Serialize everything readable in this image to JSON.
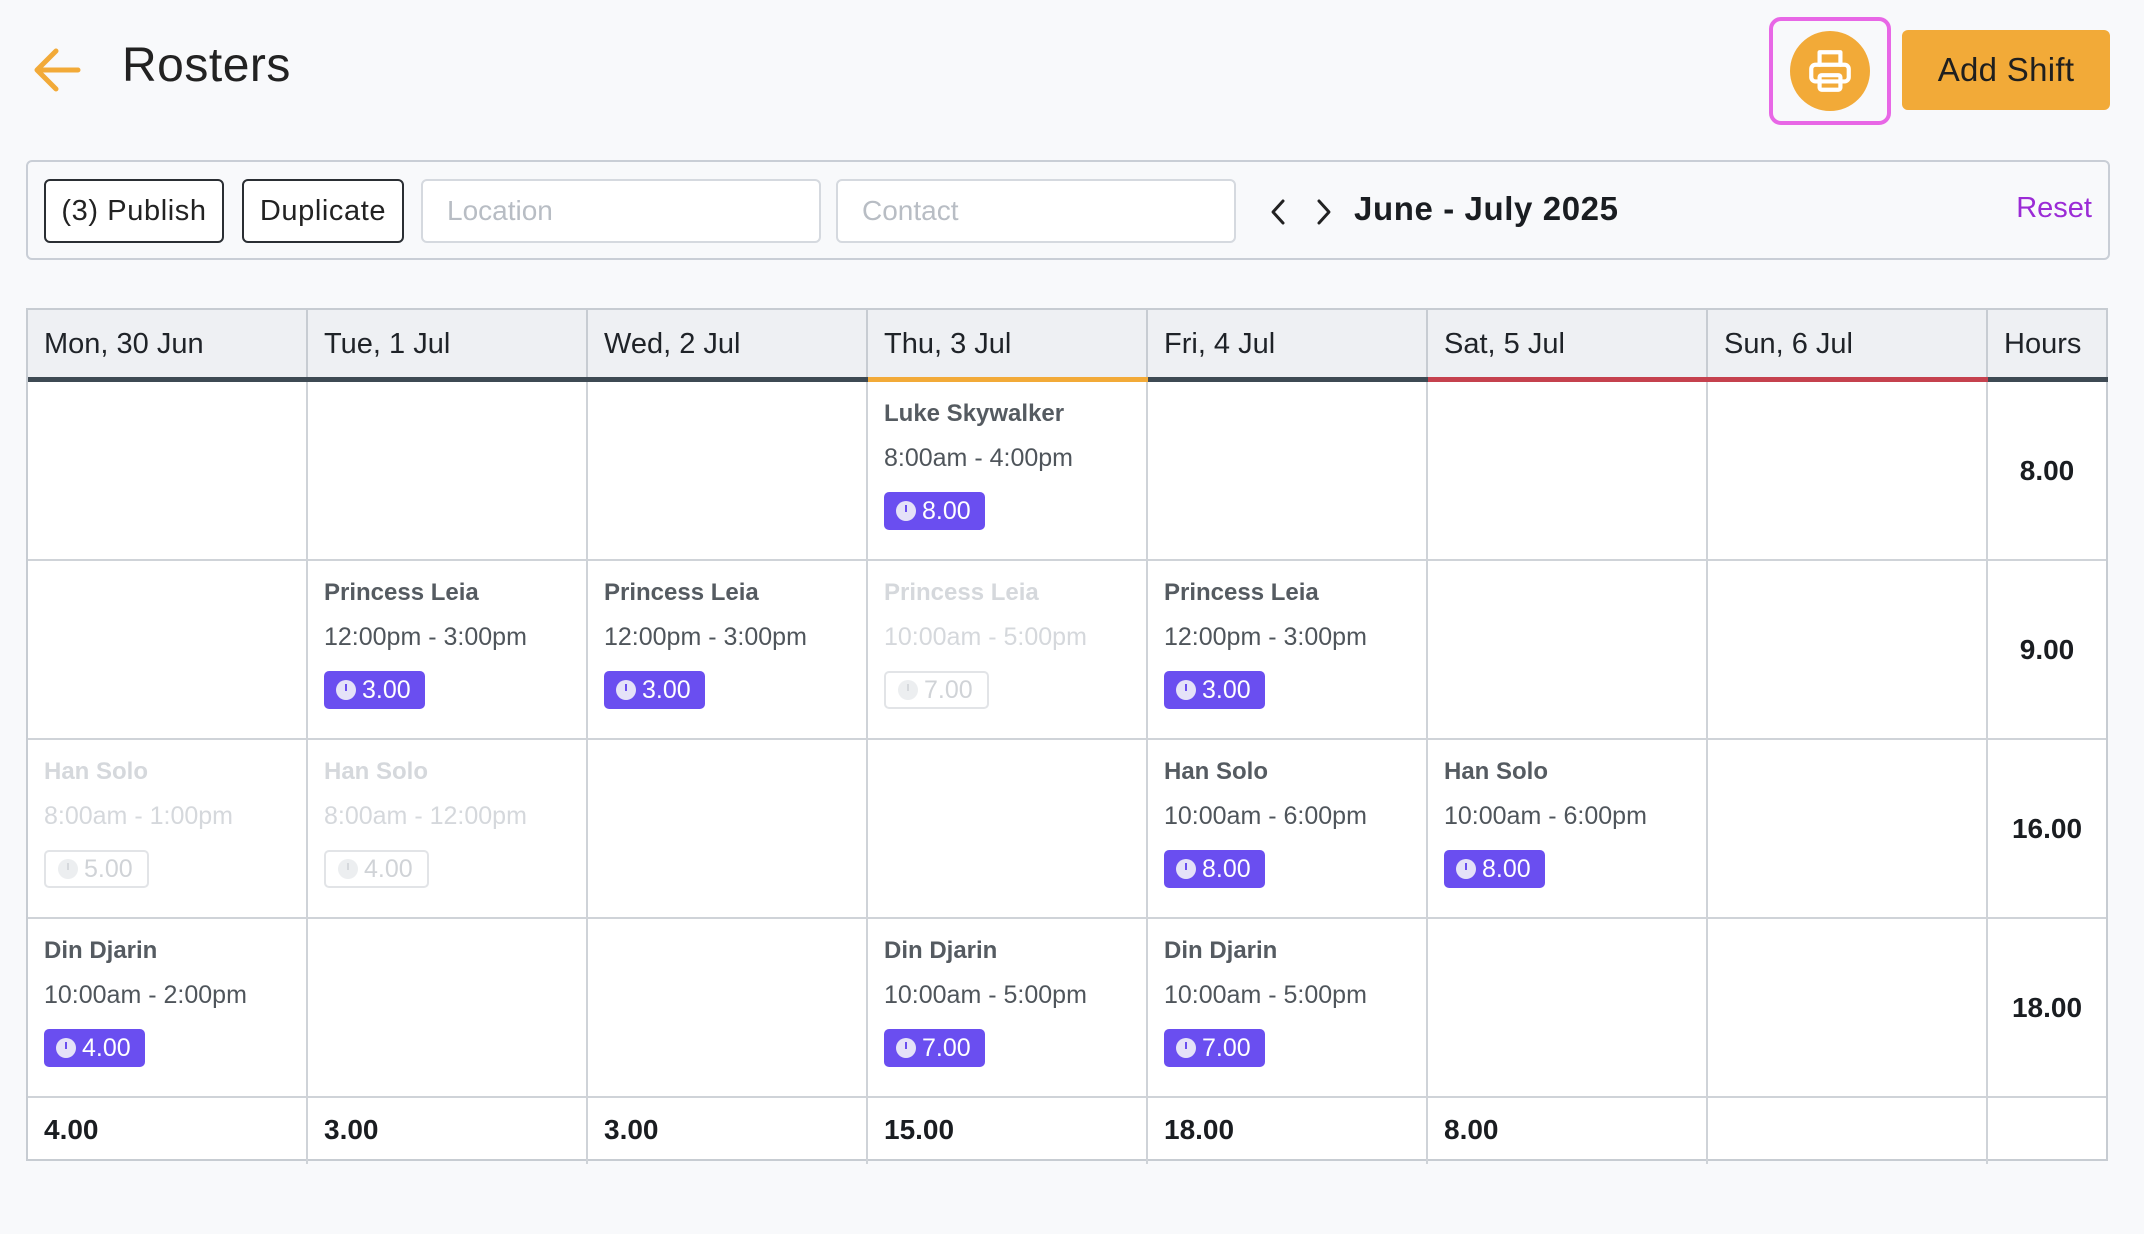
{
  "header": {
    "title": "Rosters",
    "add_shift_label": "Add Shift",
    "accent_color": "#f2aa38"
  },
  "toolbar": {
    "publish_label": "(3) Publish",
    "duplicate_label": "Duplicate",
    "location_placeholder": "Location",
    "contact_placeholder": "Contact",
    "range_label": "June - July 2025",
    "reset_label": "Reset"
  },
  "grid": {
    "days": [
      {
        "label": "Mon, 30 Jun",
        "bar_color": "#3e4a53"
      },
      {
        "label": "Tue, 1 Jul",
        "bar_color": "#3e4a53"
      },
      {
        "label": "Wed, 2 Jul",
        "bar_color": "#3e4a53"
      },
      {
        "label": "Thu, 3 Jul",
        "bar_color": "#f2aa38"
      },
      {
        "label": "Fri, 4 Jul",
        "bar_color": "#3e4a53"
      },
      {
        "label": "Sat, 5 Jul",
        "bar_color": "#c5414e"
      },
      {
        "label": "Sun, 6 Jul",
        "bar_color": "#c5414e"
      }
    ],
    "hours_header": "Hours",
    "rows": [
      {
        "hours": "8.00",
        "cells": [
          null,
          null,
          null,
          {
            "name": "Luke Skywalker",
            "time": "8:00am - 4:00pm",
            "hours": "8.00",
            "faded": false
          },
          null,
          null,
          null
        ]
      },
      {
        "hours": "9.00",
        "cells": [
          null,
          {
            "name": "Princess Leia",
            "time": "12:00pm - 3:00pm",
            "hours": "3.00",
            "faded": false
          },
          {
            "name": "Princess Leia",
            "time": "12:00pm - 3:00pm",
            "hours": "3.00",
            "faded": false
          },
          {
            "name": "Princess Leia",
            "time": "10:00am - 5:00pm",
            "hours": "7.00",
            "faded": true
          },
          {
            "name": "Princess Leia",
            "time": "12:00pm - 3:00pm",
            "hours": "3.00",
            "faded": false
          },
          null,
          null
        ]
      },
      {
        "hours": "16.00",
        "cells": [
          {
            "name": "Han Solo",
            "time": "8:00am - 1:00pm",
            "hours": "5.00",
            "faded": true
          },
          {
            "name": "Han Solo",
            "time": "8:00am - 12:00pm",
            "hours": "4.00",
            "faded": true
          },
          null,
          null,
          {
            "name": "Han Solo",
            "time": "10:00am - 6:00pm",
            "hours": "8.00",
            "faded": false
          },
          {
            "name": "Han Solo",
            "time": "10:00am - 6:00pm",
            "hours": "8.00",
            "faded": false
          },
          null
        ]
      },
      {
        "hours": "18.00",
        "cells": [
          {
            "name": "Din Djarin",
            "time": "10:00am - 2:00pm",
            "hours": "4.00",
            "faded": false
          },
          null,
          null,
          {
            "name": "Din Djarin",
            "time": "10:00am - 5:00pm",
            "hours": "7.00",
            "faded": false
          },
          {
            "name": "Din Djarin",
            "time": "10:00am - 5:00pm",
            "hours": "7.00",
            "faded": false
          },
          null,
          null
        ]
      }
    ],
    "totals": [
      "4.00",
      "3.00",
      "3.00",
      "15.00",
      "18.00",
      "8.00",
      "",
      ""
    ]
  }
}
